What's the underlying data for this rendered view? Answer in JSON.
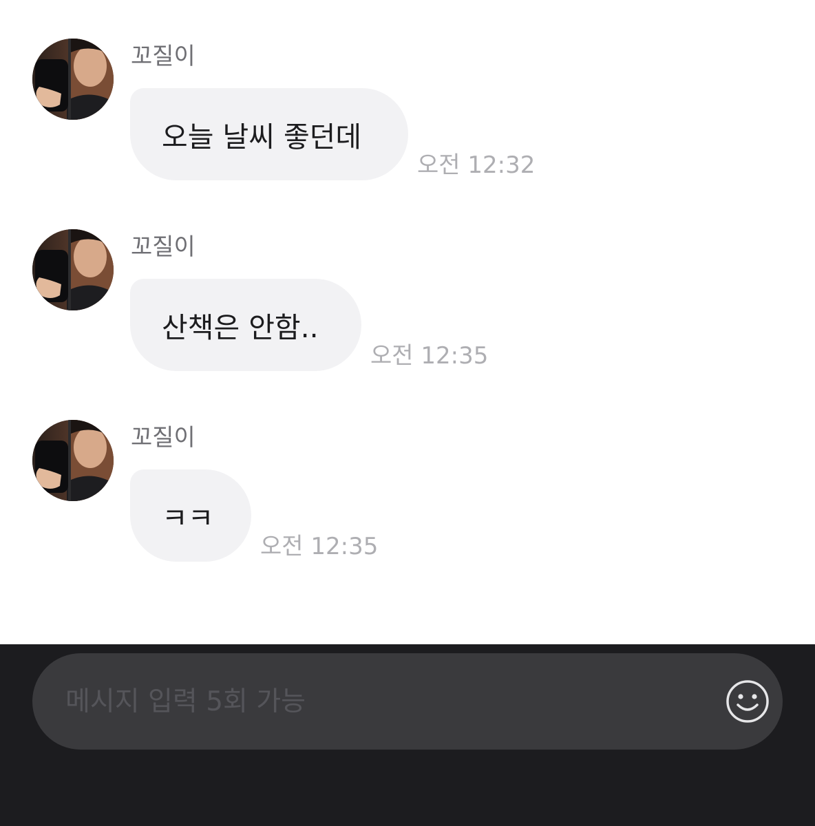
{
  "messages": [
    {
      "sender": "꼬질이",
      "text": "오늘 날씨 좋던데",
      "time": "오전 12:32"
    },
    {
      "sender": "꼬질이",
      "text": "산책은 안함..",
      "time": "오전 12:35"
    },
    {
      "sender": "꼬질이",
      "text": "ㅋㅋ",
      "time": "오전 12:35"
    }
  ],
  "composer": {
    "placeholder": "메시지 입력 5회 가능",
    "emoji_icon": "smiley-icon"
  },
  "colors": {
    "bubble": "#f2f2f4",
    "composer_bg": "#1c1c1f",
    "composer_field": "#3a3a3d",
    "timestamp": "#aeaeb2"
  }
}
